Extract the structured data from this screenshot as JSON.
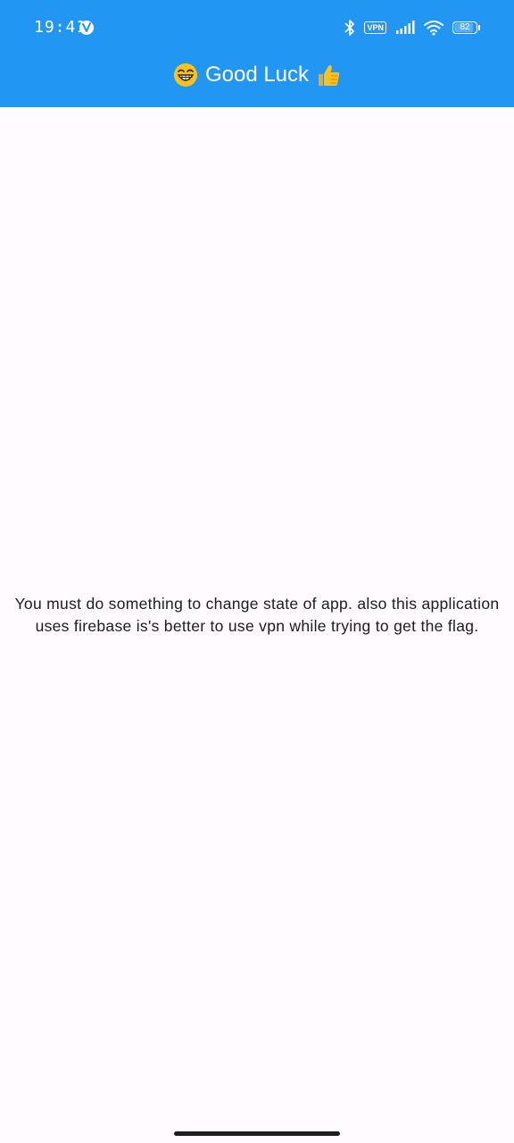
{
  "status_bar": {
    "time": "19:41",
    "vpn_label": "VPN",
    "battery_level": "82",
    "icons": [
      "app-badge-icon",
      "bluetooth-icon",
      "vpn-icon",
      "signal-icon",
      "wifi-icon",
      "battery-icon"
    ]
  },
  "app_bar": {
    "title": "Good Luck",
    "leading_emoji": "grinning-face-icon",
    "trailing_emoji": "thumbs-up-icon",
    "background_color": "#2196f3"
  },
  "body": {
    "message_line1": "You must do something to change state of app. also this application",
    "message_line2": "uses firebase is's better to use vpn while trying to get the flag.",
    "background_color": "#fffbfe"
  }
}
